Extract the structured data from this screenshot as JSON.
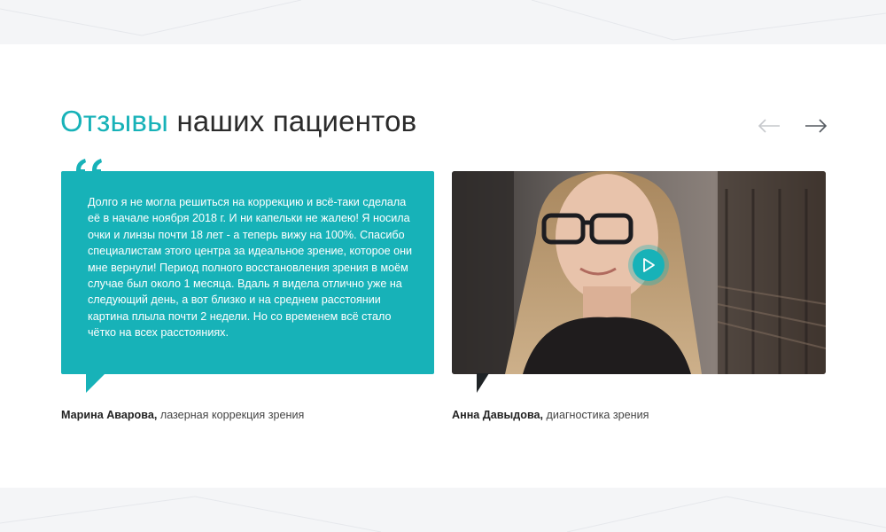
{
  "section": {
    "title_accent": "Отзывы",
    "title_rest": " наших пациентов"
  },
  "navigation": {
    "prev_icon": "arrow-left-icon",
    "next_icon": "arrow-right-icon"
  },
  "reviews": [
    {
      "type": "text",
      "text": "Долго я не могла решиться на коррекцию и всё-таки сделала её в начале ноября 2018 г. И ни капельки не жалею! Я носила очки и линзы почти 18 лет - а теперь вижу на 100%. Спасибо специалистам этого центра за идеальное зрение, которое они мне вернули! Период полного восстановления зрения в моём случае был около 1 месяца. Вдаль я видела отлично уже на следующий день, а вот близко и на среднем расстоянии картина плыла почти 2 недели. Но со временем всё стало чётко на всех расстояниях.",
      "author_name": "Марина Аварова,",
      "author_service": " лазерная коррекция зрения"
    },
    {
      "type": "video",
      "author_name": "Анна Давыдова,",
      "author_service": " диагностика зрения"
    }
  ],
  "colors": {
    "accent": "#17b2b8",
    "title": "#2b2b2b",
    "tail_dark": "#1f2326"
  }
}
